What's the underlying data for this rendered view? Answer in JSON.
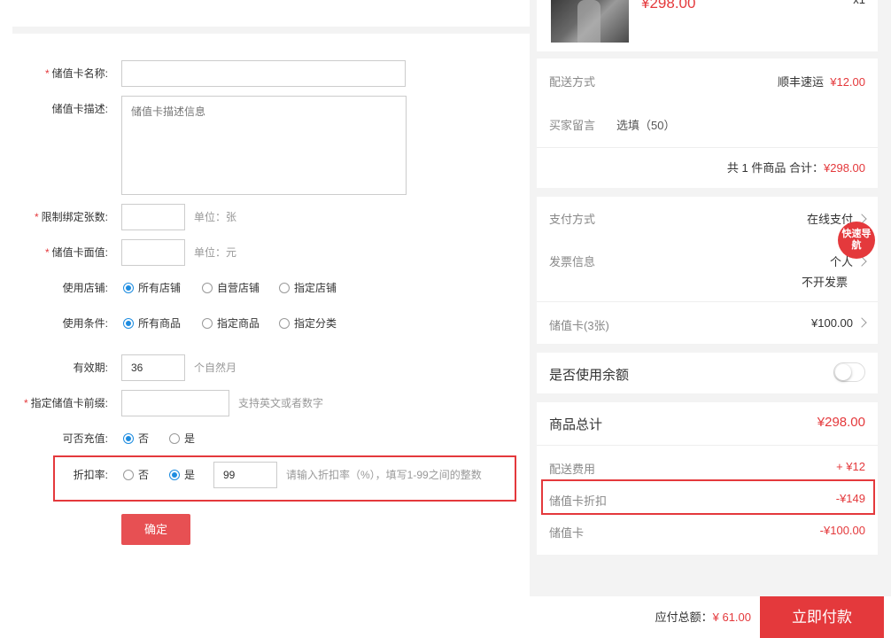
{
  "form": {
    "name": {
      "label": "储值卡名称:",
      "value": "",
      "required": true
    },
    "desc": {
      "label": "储值卡描述:",
      "placeholder": "储值卡描述信息"
    },
    "limit": {
      "label": "限制绑定张数:",
      "value": "",
      "unit": "单位：张",
      "required": true
    },
    "face": {
      "label": "储值卡面值:",
      "value": "",
      "unit": "单位：元",
      "required": true
    },
    "store": {
      "label": "使用店铺:",
      "options": [
        "所有店铺",
        "自营店铺",
        "指定店铺"
      ],
      "selected": "所有店铺"
    },
    "condition": {
      "label": "使用条件:",
      "options": [
        "所有商品",
        "指定商品",
        "指定分类"
      ],
      "selected": "所有商品"
    },
    "validity": {
      "label": "有效期:",
      "value": "36",
      "unit": "个自然月"
    },
    "prefix": {
      "label": "指定储值卡前缀:",
      "value": "",
      "hint": "支持英文或者数字",
      "required": true
    },
    "recharge": {
      "label": "可否充值:",
      "options": [
        "否",
        "是"
      ],
      "selected": "否"
    },
    "discount": {
      "label": "折扣率:",
      "options": [
        "否",
        "是"
      ],
      "selected": "是",
      "value": "99",
      "hint": "请输入折扣率（%），填写1-99之间的整数"
    },
    "confirm_label": "确定"
  },
  "order": {
    "product_price": "¥298.00",
    "product_qty": "x1",
    "shipping_label": "配送方式",
    "shipping_value": "顺丰速运",
    "shipping_fee": "¥12.00",
    "message_label": "买家留言",
    "message_placeholder": "选填（50）",
    "subtotal_prefix": "共 1 件商品 合计：",
    "subtotal_value": "¥298.00",
    "payment_label": "支付方式",
    "payment_value": "在线支付",
    "invoice_label": "发票信息",
    "invoice_value": "个人",
    "invoice_value2": "不开发票",
    "card_label": "储值卡(3张)",
    "card_value": "¥100.00",
    "balance_label": "是否使用余额",
    "goods_total_label": "商品总计",
    "goods_total_value": "¥298.00",
    "ship_fee_label": "配送费用",
    "ship_fee_value": "+ ¥12",
    "card_discount_label": "储值卡折扣",
    "card_discount_value": "-¥149",
    "card_deduct_label": "储值卡",
    "card_deduct_value": "-¥100.00",
    "quicknav_label": "快速导航"
  },
  "bottom": {
    "total_label": "应付总额：",
    "total_value": "¥ 61.00",
    "pay_label": "立即付款"
  },
  "colors": {
    "accent": "#e4393c",
    "radio": "#1d8ce0"
  }
}
